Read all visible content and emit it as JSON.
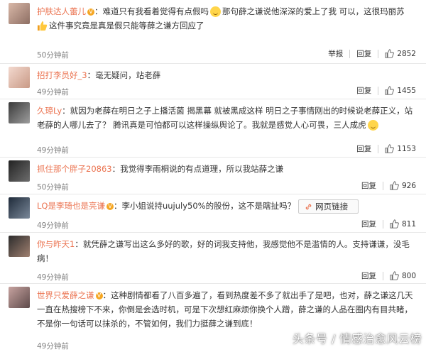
{
  "comments": [
    {
      "user": "护肤达人蕾儿",
      "verified": true,
      "sep": "：",
      "text_a": "难道只有我看着觉得有点假吗",
      "emoji1": "laugh-emoji",
      "text_b": "那句薛之谦说他深深的爱上了我 可以，这很玛丽苏",
      "emoji2": "thumb-emoji",
      "text_c": "这件事究竟是真是假只能等薛之谦方回应了",
      "time": "50分钟前",
      "report": "举报",
      "reply": "回复",
      "likes": "2852"
    },
    {
      "user": "招打李员好_3",
      "verified": false,
      "sep": "：",
      "text": "毫无疑问，站老薛",
      "time": "49分钟前",
      "reply": "回复",
      "likes": "1455"
    },
    {
      "user": "久璋Ly",
      "verified": false,
      "sep": "：",
      "text": "就因为老薛在明日之子上播活菌 揭黑幕 就被黑成这样 明日之子事情刚出的时候说老薛正义，站老薛的人哪儿去了？ 腾讯真是可怕都可以这样操纵舆论了。我就是感觉人心可畏，三人成虎",
      "emoji": "smile-emoji",
      "time": "49分钟前",
      "reply": "回复",
      "likes": "1153"
    },
    {
      "user": "抓住那个胖子20863",
      "verified": false,
      "sep": "：",
      "text": "我觉得李雨桐说的有点道理，所以我站薛之谦",
      "time": "50分钟前",
      "reply": "回复",
      "likes": "926"
    },
    {
      "user": "LQ是李琦也是亮谦",
      "verified": true,
      "sep": "：",
      "text": "李小姐说持uujuly50%的股份，这不是瞎扯吗？",
      "link": "网页链接",
      "time": "49分钟前",
      "reply": "回复",
      "likes": "811"
    },
    {
      "user": "你与昨天1",
      "verified": false,
      "sep": "：",
      "text": "就凭薛之谦写出这么多好的歌，好的词我支持他，我感觉他不是滥情的人。支持谦谦，没毛病！",
      "time": "49分钟前",
      "reply": "回复",
      "likes": "800"
    },
    {
      "user": "世界只爱薛之谦",
      "verified": true,
      "sep": "：",
      "text": "这种剧情都看了八百多遍了，看到热度差不多了就出手了是吧，也对，薛之谦这几天一直在热搜榜下不来，你倒是会选时机，可是下次想红麻烦你换个人蹭，薛之谦的人品在圈内有目共睹，不是你一句话可以抹杀的，不管如何，我们力挺薛之谦到底！",
      "time": "49分钟前"
    }
  ],
  "watermark": "头条号 / 情感治愈风云榜",
  "colors": {
    "username": "#eb7350",
    "badge": "#f5a623",
    "meta": "#808080"
  }
}
